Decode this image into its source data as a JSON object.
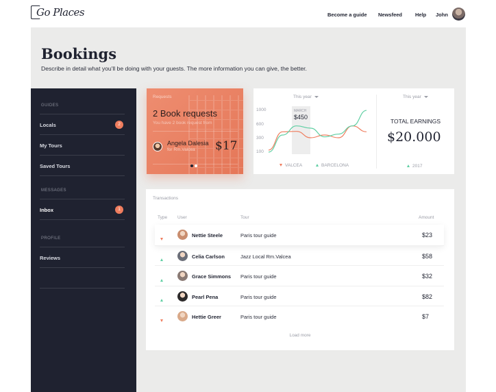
{
  "app": {
    "logo_text": "Go Places"
  },
  "nav": {
    "items": [
      "Become a guide",
      "Newsfeed",
      "Help",
      "John"
    ]
  },
  "page": {
    "title": "Bookings",
    "description": "Describe in detail what you'll be doing with your guests. The more information you can give, the better."
  },
  "sidebar": {
    "sections": [
      {
        "heading": "GUIDES",
        "items": [
          {
            "label": "Locals",
            "badge": "2"
          },
          {
            "label": "My Tours",
            "badge": ""
          },
          {
            "label": "Saved Tours",
            "badge": ""
          }
        ]
      },
      {
        "heading": "MESSAGES",
        "items": [
          {
            "label": "Inbox",
            "badge": "1"
          }
        ]
      },
      {
        "heading": "PROFILE",
        "items": [
          {
            "label": "Reviews",
            "badge": ""
          }
        ]
      }
    ]
  },
  "requests": {
    "label": "Requests",
    "title": "2 Book requests",
    "subtitle": "You have 2 book request from",
    "name": "Angela Dalesia",
    "for": "for Rm.Valcea",
    "price": "$17",
    "colors": {
      "active_dot": "#1f2230",
      "inactive_dot": "#ffffff"
    }
  },
  "chart_data": {
    "type": "line",
    "period_selector": "This year",
    "y_ticks": [
      "1000",
      "600",
      "300",
      "100"
    ],
    "highlight": {
      "label": "MARCH",
      "value": "$450"
    },
    "series": [
      {
        "name": "VALCEA",
        "color": "#ef7d5e",
        "values": [
          120,
          430,
          440,
          300,
          360,
          300,
          560,
          430
        ]
      },
      {
        "name": "BARCELONA",
        "color": "#5fcfa3",
        "values": [
          80,
          360,
          560,
          510,
          320,
          380,
          560,
          980
        ]
      }
    ]
  },
  "earnings": {
    "period_selector": "This year",
    "label": "TOTAL EARNINGS",
    "value": "$20.000",
    "year": "2017"
  },
  "transactions": {
    "title": "Transactions",
    "headers": {
      "type": "Type",
      "user": "User",
      "tour": "Tour",
      "amount": "Amount"
    },
    "rows": [
      {
        "direction": "down",
        "user": "Nettie Steele",
        "tour": "Paris tour guide",
        "amount": "$23",
        "avatar_color": "#c98d6e"
      },
      {
        "direction": "up",
        "user": "Celia Carlson",
        "tour": "Jazz Local Rm.Valcea",
        "amount": "$58",
        "avatar_color": "#6b6e78"
      },
      {
        "direction": "up",
        "user": "Grace Simmons",
        "tour": "Paris tour guide",
        "amount": "$32",
        "avatar_color": "#8a7a74"
      },
      {
        "direction": "up",
        "user": "Pearl Pena",
        "tour": "Paris tour guide",
        "amount": "$82",
        "avatar_color": "#2d2a2a"
      },
      {
        "direction": "down",
        "user": "Hettie Greer",
        "tour": "Paris tour guide",
        "amount": "$7",
        "avatar_color": "#d9a989"
      }
    ],
    "load_more": "Load more"
  }
}
